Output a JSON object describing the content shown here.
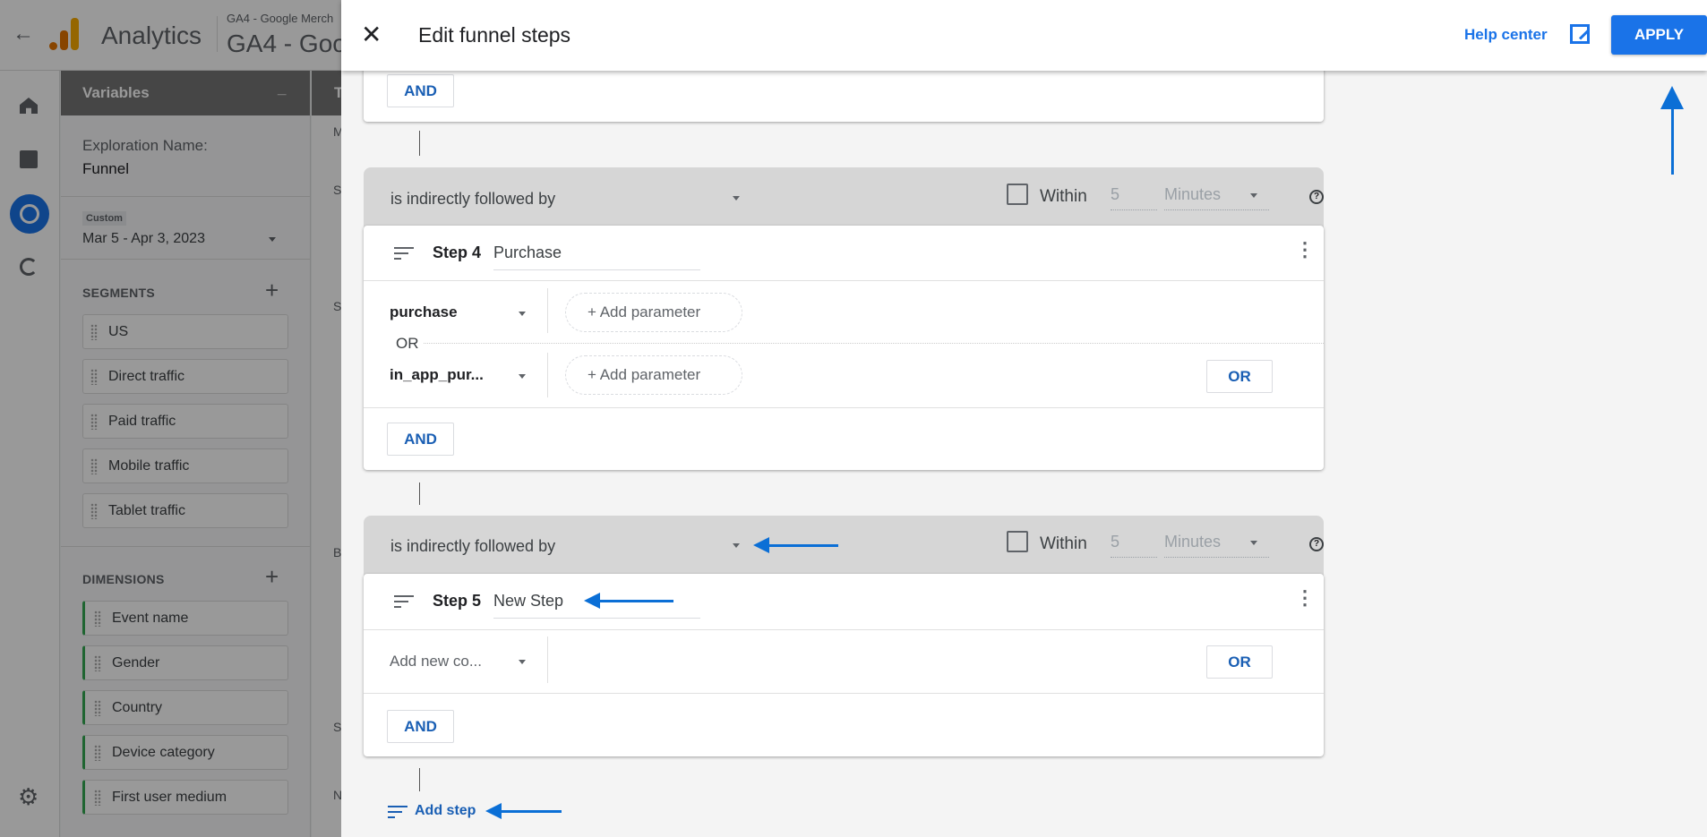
{
  "app": {
    "back_icon": "arrow-left-icon",
    "product": "Analytics",
    "account": "GA4 - Google Merch",
    "property": "GA4 - Goo"
  },
  "rail": {
    "icons": [
      "home-icon",
      "reports-icon",
      "explore-icon",
      "advertising-icon",
      "gear-icon"
    ]
  },
  "variables": {
    "title": "Variables",
    "collapse": "_",
    "exploration_label": "Exploration Name:",
    "exploration_name": "Funnel",
    "date_badge": "Custom",
    "date_range": "Mar 5 - Apr 3, 2023",
    "segments_label": "SEGMENTS",
    "segments": [
      "US",
      "Direct traffic",
      "Paid traffic",
      "Mobile traffic",
      "Tablet traffic"
    ],
    "dimensions_label": "DIMENSIONS",
    "dimensions": [
      "Event name",
      "Gender",
      "Country",
      "Device category",
      "First user medium"
    ]
  },
  "tabcol": {
    "letters": [
      "T",
      "M",
      "S",
      "S",
      "B",
      "S",
      "N"
    ]
  },
  "panel": {
    "title": "Edit funnel steps",
    "help": "Help center",
    "apply": "APPLY",
    "top_card": {
      "and": "AND"
    },
    "step4": {
      "relation": "is indirectly followed by",
      "within": "Within",
      "within_value": "5",
      "unit": "Minutes",
      "step_label": "Step 4",
      "name": "Purchase",
      "conditions": [
        {
          "event": "purchase",
          "add": "Add parameter"
        },
        {
          "event": "in_app_pur...",
          "add": "Add parameter"
        }
      ],
      "or_label": "OR",
      "or_button": "OR",
      "and_button": "AND"
    },
    "step5": {
      "relation": "is indirectly followed by",
      "within": "Within",
      "within_value": "5",
      "unit": "Minutes",
      "step_label": "Step 5",
      "name": "New Step",
      "condition_placeholder": "Add new co...",
      "or_button": "OR",
      "and_button": "AND"
    },
    "add_step": "Add step"
  },
  "colors": {
    "accent": "#1a73e8",
    "annotation_arrow": "#0b6fd6",
    "dimension_bar": "#34a853"
  }
}
